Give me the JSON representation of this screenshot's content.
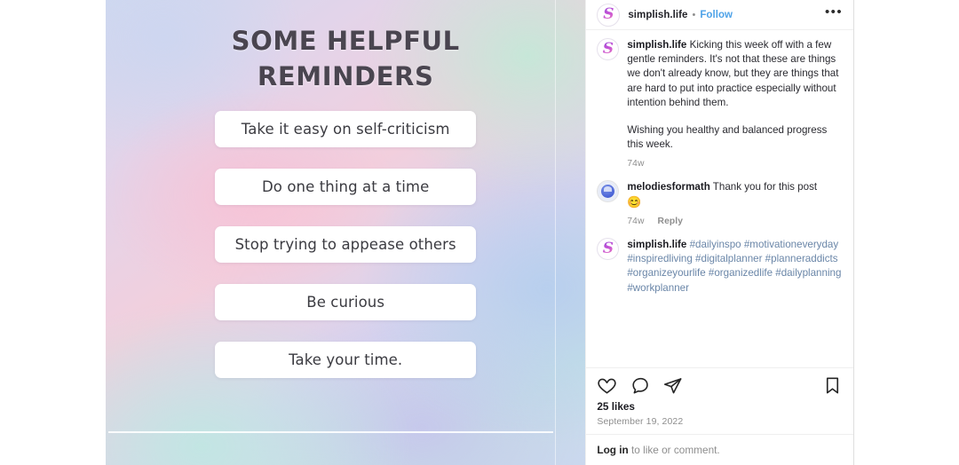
{
  "post_image": {
    "title": "SOME HELPFUL REMINDERS",
    "reminders": [
      "Take it easy on self-criticism",
      "Do one thing at a time",
      "Stop trying to appease others",
      "Be curious",
      "Take your time."
    ]
  },
  "header": {
    "username": "simplish.life",
    "separator": "•",
    "follow_label": "Follow",
    "more_label": "•••"
  },
  "caption": {
    "username": "simplish.life",
    "paragraph1": "Kicking this week off with a few gentle reminders. It's not that these are things we don't already know, but they are things that are hard to put into practice especially without intention behind them.",
    "paragraph2": "Wishing you healthy and balanced progress this week.",
    "time": "74w"
  },
  "comment": {
    "username": "melodiesformath",
    "text": "Thank you for this post",
    "emoji": "😊",
    "time": "74w",
    "reply_label": "Reply"
  },
  "hashtag_comment": {
    "username": "simplish.life",
    "hashtags": "#dailyinspo #motivationeveryday #inspiredliving #digitalplanner #planneraddicts #organizeyourlife #organizedlife #dailyplanning #workplanner"
  },
  "actions": {
    "like": "like-icon",
    "comment": "comment-icon",
    "share": "share-icon",
    "save": "save-icon"
  },
  "stats": {
    "likes": "25 likes",
    "date": "September 19, 2022"
  },
  "login_prompt": {
    "link": "Log in",
    "rest": " to like or comment."
  },
  "colors": {
    "accent_link": "#4da2e8",
    "hashtag": "#6a86a8",
    "muted_text": "#8e8e8e"
  }
}
